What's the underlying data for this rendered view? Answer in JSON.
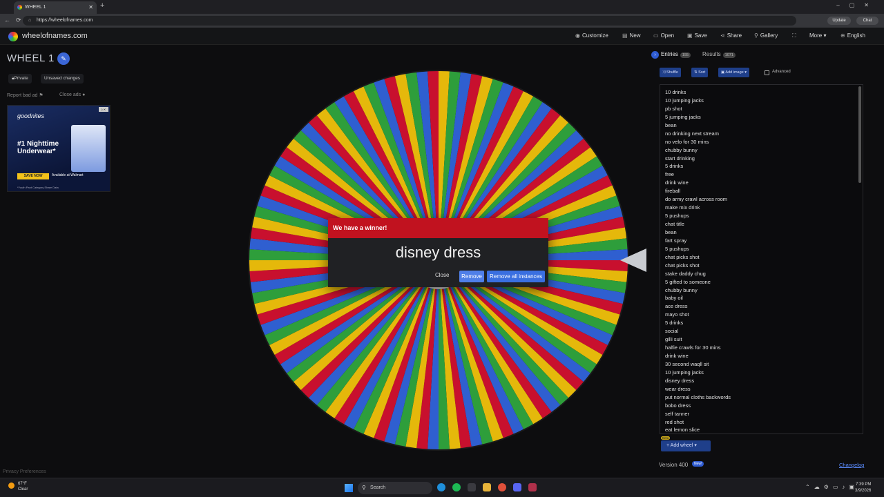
{
  "browser": {
    "tab_title": "WHEEL 1",
    "url": "https://wheelofnames.com",
    "update_label": "Update",
    "chat_label": "Chat"
  },
  "site": {
    "brand": "wheelofnames.com",
    "nav": {
      "customize": "Customize",
      "new": "New",
      "open": "Open",
      "save": "Save",
      "share": "Share",
      "gallery": "Gallery",
      "more": "More",
      "language": "English"
    }
  },
  "left": {
    "wheel_title": "WHEEL 1",
    "private_label": "Private",
    "unsaved_label": "Unsaved changes",
    "report_ad": "Report bad ad",
    "close_ads": "Close ads",
    "privacy": "Privacy Preferences"
  },
  "ad": {
    "brand": "goodnites",
    "headline": "#1 Nighttime Underwear*",
    "cta": "SAVE NOW",
    "retailer": "Available at Walmart",
    "fine_print": "*Youth Pant Category Share Data"
  },
  "wheel": {
    "colors": [
      "#c8102e",
      "#e5b80b",
      "#2e9e3b",
      "#2f5fd0"
    ],
    "slice_count": 108
  },
  "modal": {
    "title": "We have a winner!",
    "winner": "disney dress",
    "close_label": "Close",
    "remove_label": "Remove",
    "remove_all_label": "Remove all instances",
    "header_color": "#c1121f"
  },
  "panel": {
    "entries_tab": "Entries",
    "entries_count": "155",
    "results_tab": "Results",
    "results_count": "1071",
    "shuffle_label": "Shuffle",
    "sort_label": "Sort",
    "add_image_label": "Add image",
    "advanced_label": "Advanced",
    "entries": [
      "10 drinks",
      "10 jumping jacks",
      "pb shot",
      "5 jumping jacks",
      "bean",
      "no drinking next stream",
      "no velo for 30 mins",
      "chubby bunny",
      "start drinking",
      "5 drinks",
      "free",
      "drink wine",
      "fireball",
      "do army crawl across room",
      "make mix drink",
      "5 pushups",
      "chat title",
      "bean",
      "fart spray",
      "5 pushups",
      "chat picks shot",
      "chat picks shot",
      "stake daddy chug",
      "5 gifted to someone",
      "chubby bunny",
      "baby oil",
      "ace dress",
      "mayo shot",
      "5 drinks",
      "social",
      "gilli suit",
      "halfie crawls for 30 mins",
      "drink wine",
      "30 second waqll sit",
      "10 jumping jacks",
      "disney dress",
      "wear dress",
      "put normal cloths backwords",
      "bobo dress",
      "self tanner",
      "red shot",
      "eat lemon slice"
    ],
    "beta_tag": "Beta",
    "add_wheel_label": "Add wheel",
    "version": "Version 400",
    "new_tag": "New!",
    "changelog": "Changelog"
  },
  "taskbar": {
    "temp": "67°F",
    "condition": "Clear",
    "search_label": "Search",
    "time": "7:39 PM",
    "date": "3/9/2026"
  }
}
